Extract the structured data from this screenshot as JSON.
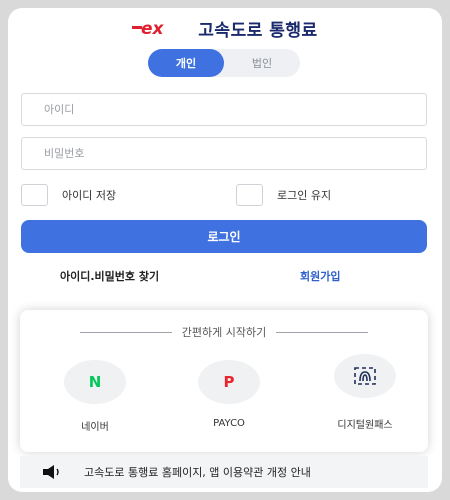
{
  "header": {
    "logo_text": "ex",
    "title": "고속도로 통행료",
    "logo_color": "#e0202e"
  },
  "tabs": [
    {
      "label": "개인",
      "active": true
    },
    {
      "label": "법인",
      "active": false
    }
  ],
  "form": {
    "id_placeholder": "아이디",
    "password_placeholder": "비밀번호",
    "save_id_label": "아이디 저장",
    "keep_login_label": "로그인 유지",
    "login_button": "로그인"
  },
  "links": {
    "find_account": "아이디.비밀번호 찾기",
    "signup": "회원가입"
  },
  "quick_login": {
    "title": "간편하게 시작하기",
    "providers": [
      {
        "label": "네이버",
        "glyph": "N",
        "color": "#03c75a",
        "icon": "naver-icon"
      },
      {
        "label": "PAYCO",
        "glyph": "P",
        "color": "#e8242c",
        "icon": "payco-icon"
      },
      {
        "label": "디지털원패스",
        "glyph": "",
        "color": "#1f2e5a",
        "icon": "digital-onepass-icon"
      }
    ]
  },
  "notice": {
    "icon": "speaker-icon",
    "text": "고속도로 통행료 홈페이지, 앱 이용약관 개정 안내"
  },
  "colors": {
    "accent": "#3f72e0",
    "brand_navy": "#1a2a6c"
  }
}
